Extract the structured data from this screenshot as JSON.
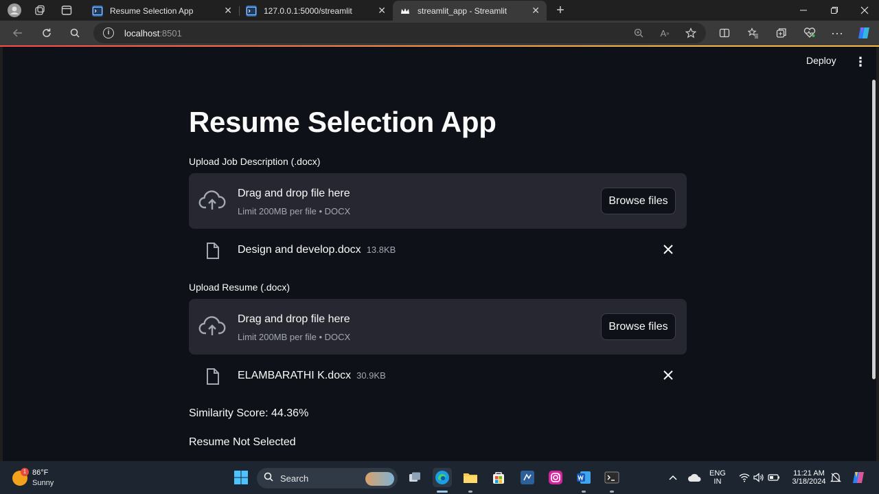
{
  "browser": {
    "tabs": [
      {
        "title": "Resume Selection App",
        "active": false
      },
      {
        "title": "127.0.0.1:5000/streamlit",
        "active": false
      },
      {
        "title": "streamlit_app - Streamlit",
        "active": true
      }
    ],
    "new_tab": "+",
    "url_host": "localhost",
    "url_port": ":8501"
  },
  "app": {
    "header": {
      "deploy_label": "Deploy",
      "menu_icon": "⋮"
    },
    "title": "Resume Selection App",
    "uploaders": [
      {
        "label": "Upload Job Description (.docx)",
        "drop_text": "Drag and drop file here",
        "limit_text": "Limit 200MB per file • DOCX",
        "browse_label": "Browse files",
        "file": {
          "name": "Design and develop.docx",
          "size": "13.8KB"
        }
      },
      {
        "label": "Upload Resume (.docx)",
        "drop_text": "Drag and drop file here",
        "limit_text": "Limit 200MB per file • DOCX",
        "browse_label": "Browse files",
        "file": {
          "name": "ELAMBARATHI K.docx",
          "size": "30.9KB"
        }
      }
    ],
    "similarity_text": "Similarity Score: 44.36%",
    "decision_text": "Resume Not Selected"
  },
  "taskbar": {
    "weather": {
      "badge": "1",
      "temp": "86°F",
      "condition": "Sunny"
    },
    "search_placeholder": "Search",
    "language": {
      "line1": "ENG",
      "line2": "IN"
    },
    "time": "11:21 AM",
    "date": "3/18/2024"
  }
}
